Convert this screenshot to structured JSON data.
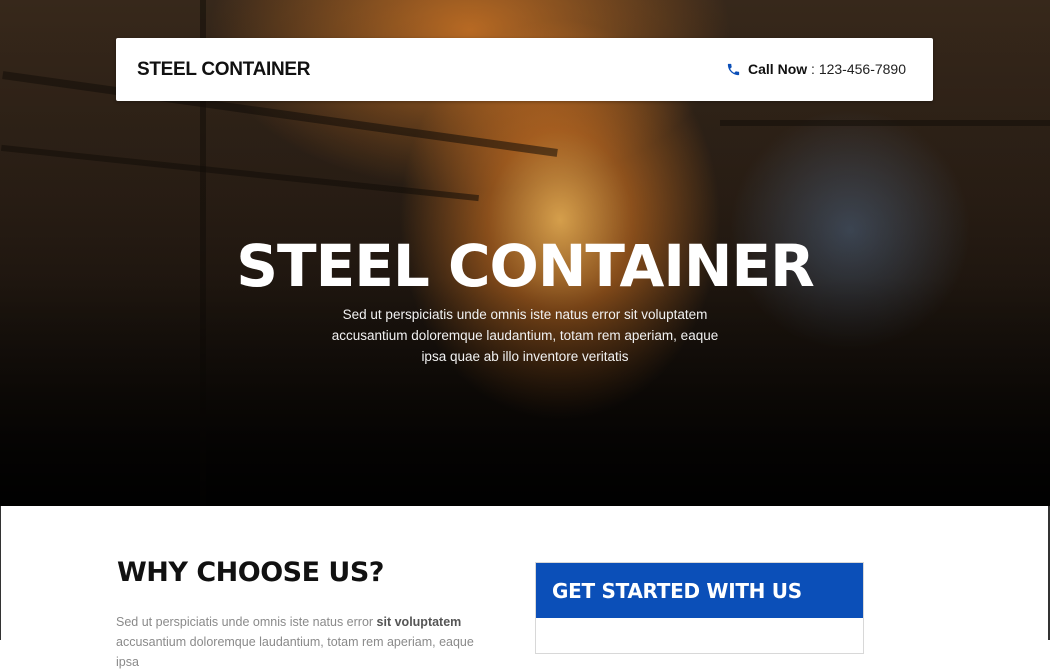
{
  "header": {
    "brand": "STEEL CONTAINER",
    "call_label": "Call Now",
    "call_separator": " : ",
    "call_number": "123-456-7890",
    "phone_icon": "phone-icon"
  },
  "hero": {
    "title": "STEEL CONTAINER",
    "subtitle": "Sed ut perspiciatis unde omnis iste natus error sit voluptatem accusantium doloremque laudantium, totam rem aperiam, eaque ipsa quae ab illo inventore veritatis"
  },
  "why": {
    "title": "WHY CHOOSE US?",
    "text_plain": "Sed ut perspiciatis unde omnis iste natus error ",
    "text_bold": "sit voluptatem",
    "text_rest": " accusantium doloremque laudantium, totam rem aperiam, eaque ipsa"
  },
  "get_started": {
    "title": "GET STARTED WITH US"
  },
  "colors": {
    "accent_blue": "#0b4fb8",
    "phone_icon_blue": "#0b4fb8"
  }
}
